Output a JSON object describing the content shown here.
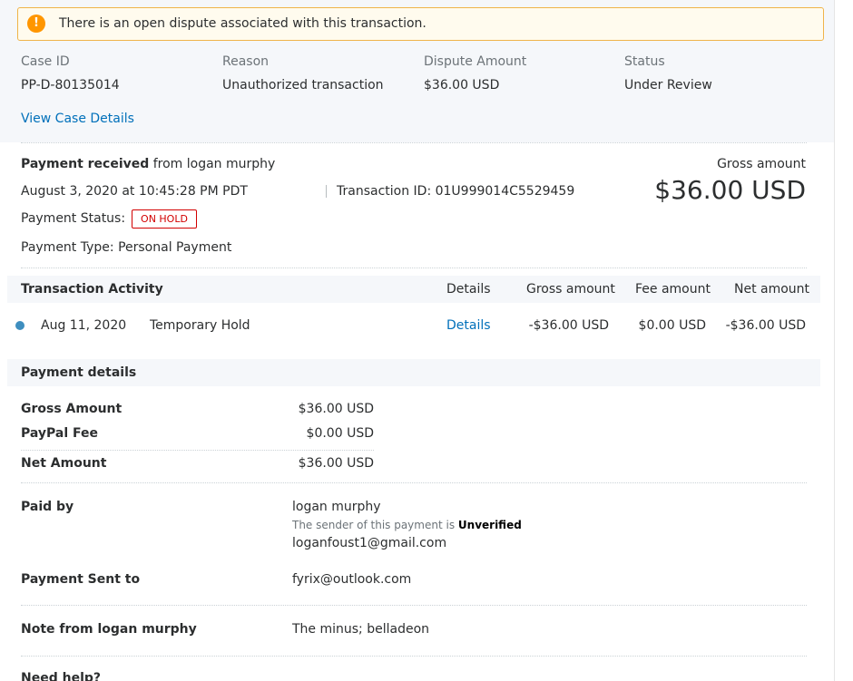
{
  "dispute": {
    "alert_text": "There is an open dispute associated with this transaction.",
    "labels": {
      "case_id": "Case ID",
      "reason": "Reason",
      "dispute_amount": "Dispute Amount",
      "status": "Status"
    },
    "values": {
      "case_id": "PP-D-80135014",
      "reason": "Unauthorized transaction",
      "dispute_amount": "$36.00 USD",
      "status": "Under Review"
    },
    "view_case_details": "View Case Details"
  },
  "payment": {
    "received_bold": "Payment received",
    "received_rest": "from logan murphy",
    "datetime": "August 3, 2020 at 10:45:28 PM PDT",
    "transaction_id": "Transaction ID: 01U999014C5529459",
    "status_label": "Payment Status:",
    "status_badge": "ON HOLD",
    "type": "Payment Type: Personal Payment",
    "gross_label": "Gross amount",
    "gross_value": "$36.00 USD"
  },
  "activity": {
    "title": "Transaction Activity",
    "columns": {
      "details": "Details",
      "gross": "Gross amount",
      "fee": "Fee amount",
      "net": "Net amount"
    },
    "rows": [
      {
        "date": "Aug 11, 2020",
        "desc": "Temporary Hold",
        "details": "Details",
        "gross": "-$36.00 USD",
        "fee": "$0.00 USD",
        "net": "-$36.00 USD"
      }
    ]
  },
  "payment_details": {
    "title": "Payment details",
    "gross_label": "Gross Amount",
    "gross_value": "$36.00 USD",
    "fee_label": "PayPal Fee",
    "fee_value": "$0.00 USD",
    "net_label": "Net Amount",
    "net_value": "$36.00 USD",
    "paid_by_label": "Paid by",
    "paid_by_name": "logan murphy",
    "sender_note": "The sender of this payment is",
    "sender_status": "Unverified",
    "paid_by_email": "loganfoust1@gmail.com",
    "sent_to_label": "Payment Sent to",
    "sent_to_value": "fyrix@outlook.com",
    "note_label": "Note from logan murphy",
    "note_value": "The minus; belladeon",
    "help_label": "Need help?"
  },
  "colors": {
    "link": "#0070ba",
    "alert_border": "#f0b44a",
    "alert_icon": "#ff9600",
    "hold": "#d20000",
    "dot": "#3e8ebf"
  }
}
